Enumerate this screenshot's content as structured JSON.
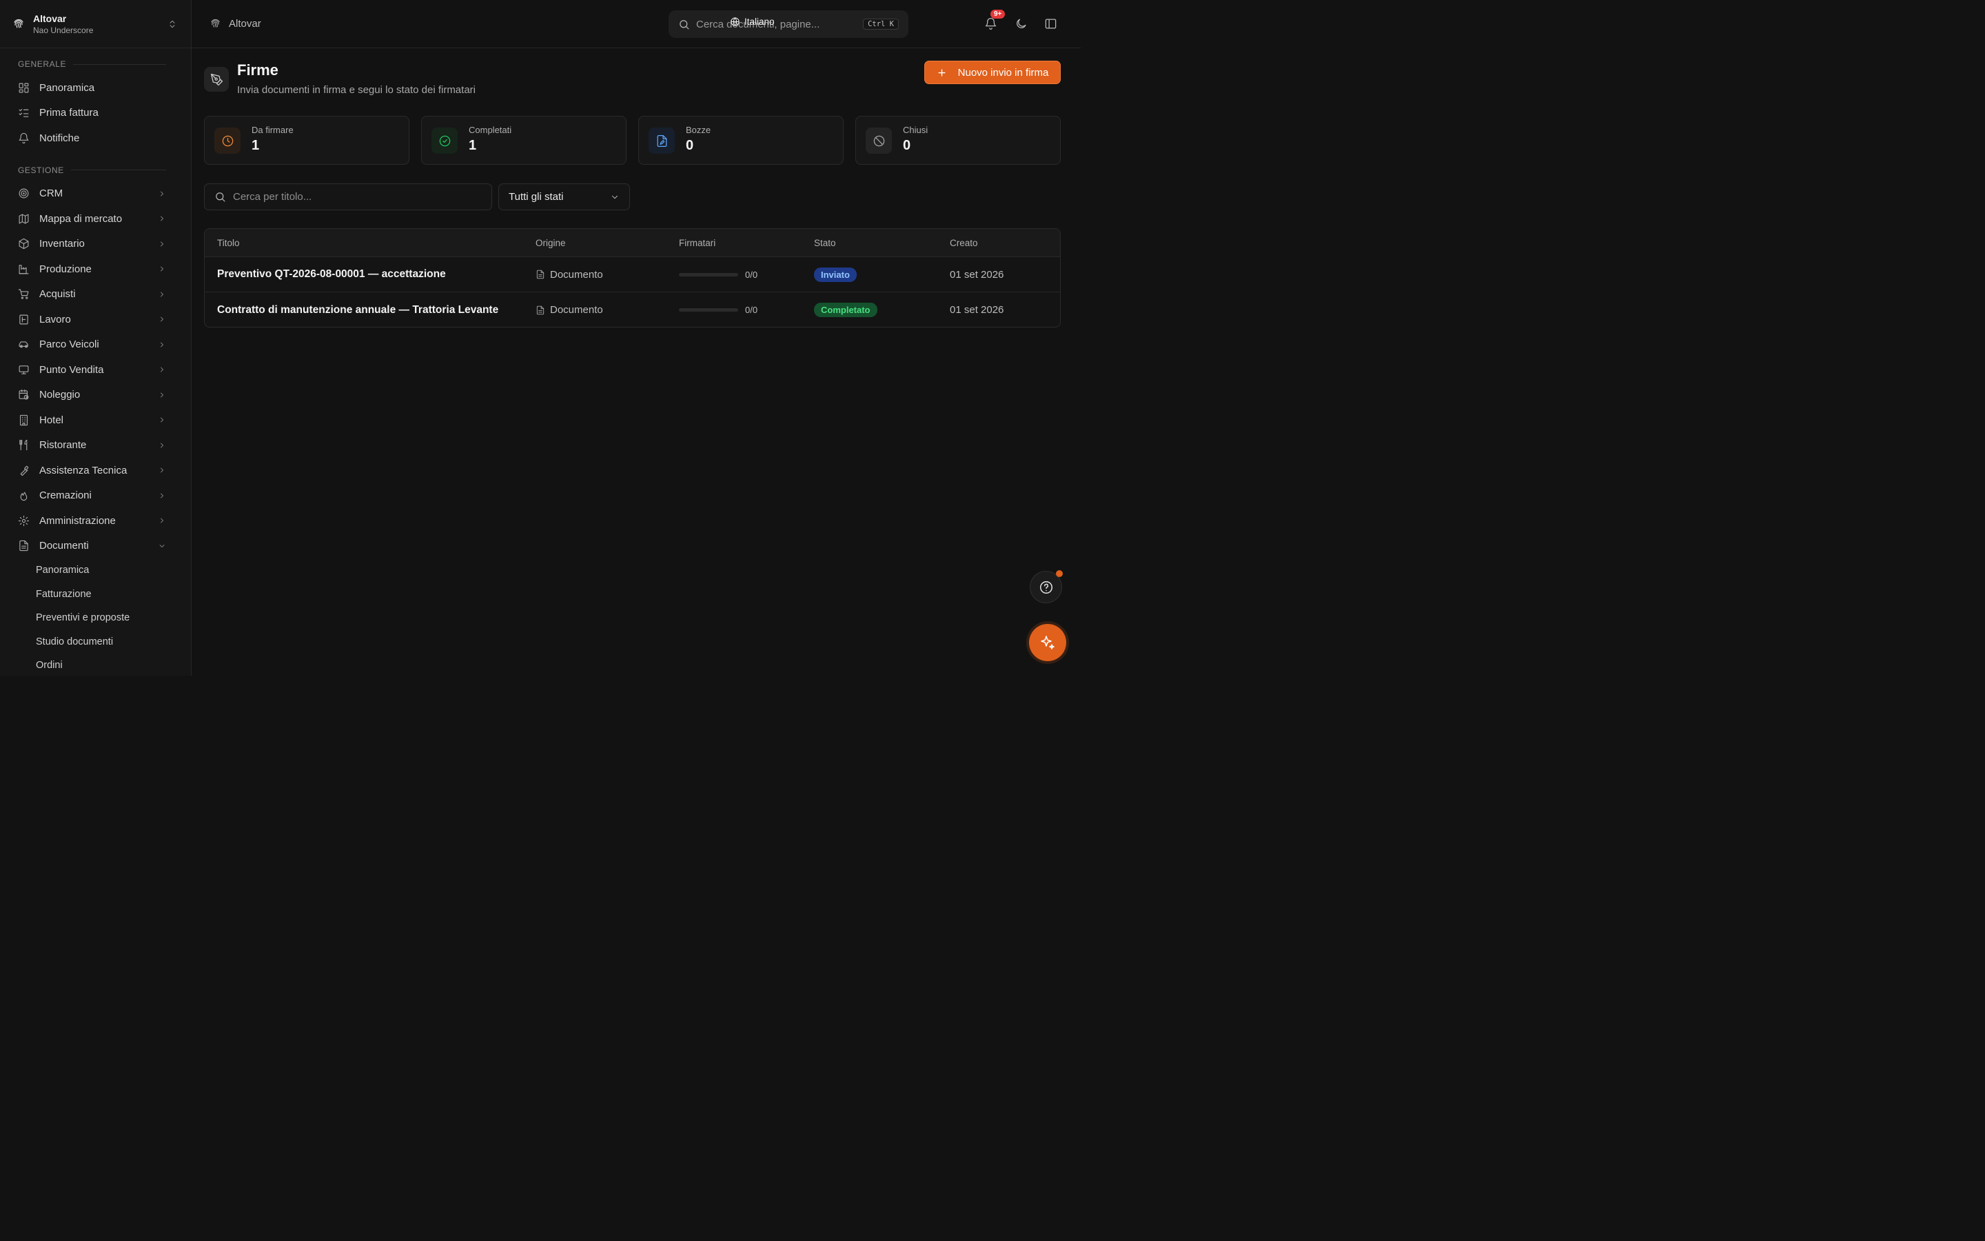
{
  "workspace": {
    "name": "Altovar",
    "user": "Nao Underscore"
  },
  "sidebar": {
    "section_general": "Generale",
    "general_items": [
      {
        "label": "Panoramica",
        "icon": "dashboard-icon"
      },
      {
        "label": "Prima fattura",
        "icon": "checklist-icon"
      },
      {
        "label": "Notifiche",
        "icon": "bell-icon"
      }
    ],
    "section_management": "Gestione",
    "management_items": [
      {
        "label": "CRM",
        "icon": "target-icon"
      },
      {
        "label": "Mappa di mercato",
        "icon": "map-icon"
      },
      {
        "label": "Inventario",
        "icon": "package-icon"
      },
      {
        "label": "Produzione",
        "icon": "factory-icon"
      },
      {
        "label": "Acquisti",
        "icon": "cart-icon"
      },
      {
        "label": "Lavoro",
        "icon": "calendar-grid-icon"
      },
      {
        "label": "Parco Veicoli",
        "icon": "car-icon"
      },
      {
        "label": "Punto Vendita",
        "icon": "monitor-icon"
      },
      {
        "label": "Noleggio",
        "icon": "calendar-clock-icon"
      },
      {
        "label": "Hotel",
        "icon": "building-icon"
      },
      {
        "label": "Ristorante",
        "icon": "utensils-icon"
      },
      {
        "label": "Assistenza Tecnica",
        "icon": "wrench-icon"
      },
      {
        "label": "Cremazioni",
        "icon": "flame-icon"
      },
      {
        "label": "Amministrazione",
        "icon": "gear-icon"
      },
      {
        "label": "Documenti",
        "icon": "file-icon"
      }
    ],
    "documenti_sub": [
      "Panoramica",
      "Fatturazione",
      "Preventivi e proposte",
      "Studio documenti",
      "Ordini"
    ]
  },
  "topbar": {
    "breadcrumb": "Altovar",
    "search_placeholder": "Cerca documenti, pagine...",
    "shortcut": "Ctrl K",
    "language": "Italiano",
    "notification_badge": "9+"
  },
  "page": {
    "title": "Firme",
    "subtitle": "Invia documenti in firma e segui lo stato dei firmatari",
    "new_button": "Nuovo invio in firma"
  },
  "stats": [
    {
      "label": "Da firmare",
      "value": "1",
      "icon": "clock-icon",
      "color": "#f08a3c",
      "bg": "#2a1f17"
    },
    {
      "label": "Completati",
      "value": "1",
      "icon": "check-circle-icon",
      "color": "#22c55e",
      "bg": "#16241a"
    },
    {
      "label": "Bozze",
      "value": "0",
      "icon": "file-edit-icon",
      "color": "#60a5fa",
      "bg": "#171f2c"
    },
    {
      "label": "Chiusi",
      "value": "0",
      "icon": "ban-icon",
      "color": "#a3a3a3",
      "bg": "#242424"
    }
  ],
  "filters": {
    "search_placeholder": "Cerca per titolo...",
    "status_value": "Tutti gli stati"
  },
  "table": {
    "headers": [
      "Titolo",
      "Origine",
      "Firmatari",
      "Stato",
      "Creato"
    ],
    "rows": [
      {
        "title": "Preventivo QT-2026-08-00001 — accettazione",
        "origin": "Documento",
        "signers": "0/0",
        "progress": 0,
        "status": "Inviato",
        "status_bg": "#1e3a8a",
        "status_fg": "#93c5fd",
        "created": "01 set 2026"
      },
      {
        "title": "Contratto di manutenzione annuale — Trattoria Levante",
        "origin": "Documento",
        "signers": "0/0",
        "progress": 0,
        "status": "Completato",
        "status_bg": "#14532d",
        "status_fg": "#4ade80",
        "created": "01 set 2026"
      }
    ]
  },
  "accent_color": "#e0601c"
}
